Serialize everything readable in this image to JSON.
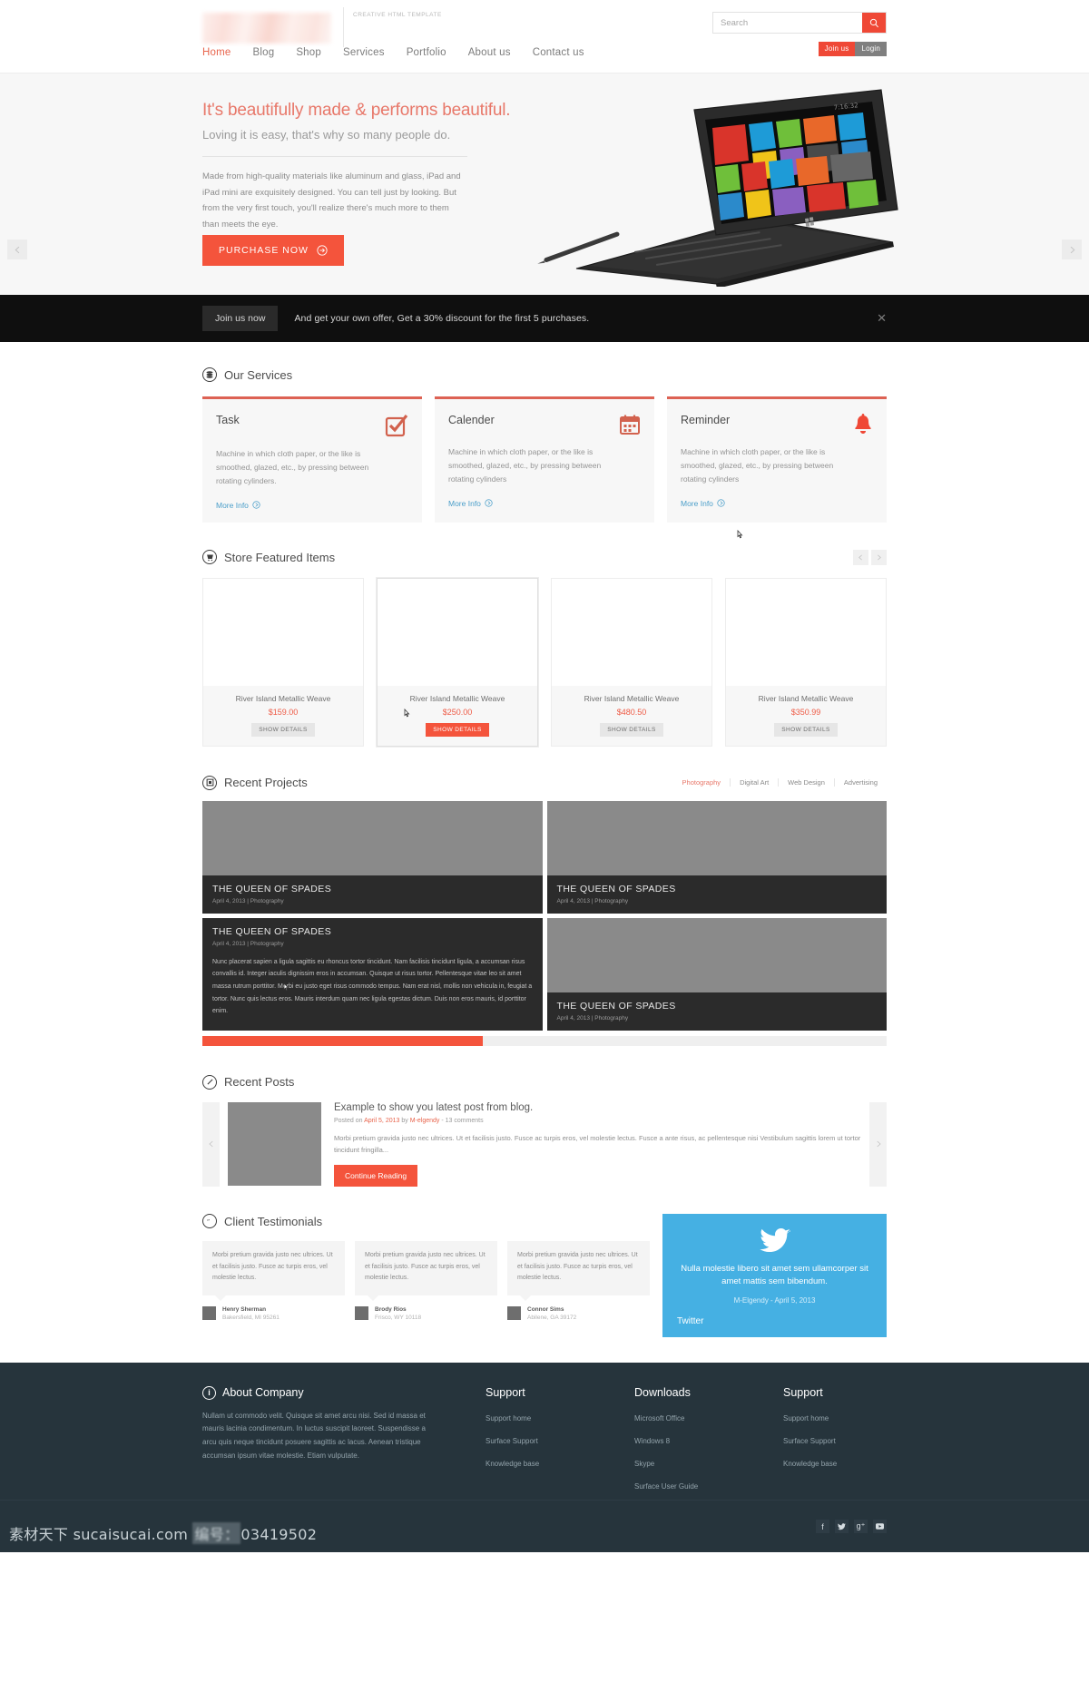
{
  "header": {
    "tagline": "CREATIVE HTML TEMPLATE",
    "nav": [
      {
        "label": "Home",
        "active": true
      },
      {
        "label": "Blog",
        "active": false
      },
      {
        "label": "Shop",
        "active": false
      },
      {
        "label": "Services",
        "active": false
      },
      {
        "label": "Portfolio",
        "active": false
      },
      {
        "label": "About us",
        "active": false
      },
      {
        "label": "Contact us",
        "active": false
      }
    ],
    "search": {
      "placeholder": "Search",
      "value": "",
      "icon": "search-icon"
    },
    "join_label": "Join us",
    "login_label": "Login"
  },
  "hero": {
    "title": "It's beautifully made & performs beautiful.",
    "subtitle": "Loving it is easy, that's why so many people do.",
    "body": "Made from high-quality materials like aluminum and glass, iPad and iPad mini are exquisitely designed. You can tell just by looking. But from the very first touch, you'll realize there's much more to them than meets the eye.",
    "cta": "PURCHASE NOW",
    "prev_icon": "chevron-left-icon",
    "next_icon": "chevron-right-icon",
    "device_screen_time": "7:16:32"
  },
  "promo": {
    "button": "Join us now",
    "text": "And get your own offer, Get a 30% discount for the first 5 purchases.",
    "close_icon": "close-icon"
  },
  "services": {
    "title": "Our Services",
    "icon": "layers-icon",
    "cards": [
      {
        "name": "Task",
        "icon": "checkbox-icon",
        "desc": "Machine in which cloth paper, or the like is smoothed, glazed, etc., by pressing between rotating cylinders.",
        "more": "More Info"
      },
      {
        "name": "Calender",
        "icon": "calendar-icon",
        "desc": "Machine in which cloth paper, or the like is smoothed, glazed, etc., by pressing between rotating cylinders",
        "more": "More Info"
      },
      {
        "name": "Reminder",
        "icon": "bell-icon",
        "desc": "Machine in which cloth paper, or the like is smoothed, glazed, etc., by pressing between rotating cylinders",
        "more": "More Info"
      }
    ]
  },
  "store": {
    "title": "Store Featured Items",
    "icon": "cart-icon",
    "prev_icon": "chevron-left-icon",
    "next_icon": "chevron-right-icon",
    "products": [
      {
        "name": "River Island Metallic Weave",
        "price": "$159.00",
        "button": "SHOW DETAILS",
        "active": false
      },
      {
        "name": "River Island Metallic Weave",
        "price": "$250.00",
        "button": "SHOW DETAILS",
        "active": true
      },
      {
        "name": "River Island Metallic Weave",
        "price": "$480.50",
        "button": "SHOW DETAILS",
        "active": false
      },
      {
        "name": "River Island Metallic Weave",
        "price": "$350.99",
        "button": "SHOW DETAILS",
        "active": false
      }
    ]
  },
  "projects": {
    "title": "Recent Projects",
    "icon": "image-icon",
    "filters": [
      {
        "label": "Photography",
        "active": true
      },
      {
        "label": "Digital Art",
        "active": false
      },
      {
        "label": "Web Design",
        "active": false
      },
      {
        "label": "Advertising",
        "active": false
      }
    ],
    "items": [
      {
        "title": "THE QUEEN OF SPADES",
        "meta": "April 4, 2013  |  Photography",
        "body": ""
      },
      {
        "title": "THE QUEEN OF SPADES",
        "meta": "April 4, 2013  |  Photography",
        "body": ""
      },
      {
        "title": "THE QUEEN OF SPADES",
        "meta": "April 4, 2013  |  Photography",
        "body": "Nunc placerat sapien a ligula sagittis eu rhoncus tortor tincidunt. Nam facilisis tincidunt ligula, a accumsan risus convallis id. Integer iaculis dignissim eros in accumsan. Quisque ut risus tortor. Pellentesque vitae leo sit amet massa rutrum porttitor. Morbi eu justo eget risus commodo tempus. Nam erat nisl, mollis non vehicula in, feugiat a tortor. Nunc quis lectus eros. Mauris interdum quam nec ligula egestas dictum. Duis non eros mauris, id porttitor enim."
      },
      {
        "title": "THE QUEEN OF SPADES",
        "meta": "April 4, 2013  |  Photography",
        "body": ""
      }
    ],
    "scroll_percent": 41
  },
  "posts": {
    "title": "Recent Posts",
    "icon": "pencil-icon",
    "prev_icon": "chevron-left-icon",
    "next_icon": "chevron-right-icon",
    "item": {
      "title": "Example to show you latest post from blog.",
      "meta_prefix": "Posted on ",
      "meta_date": "April 5, 2013",
      "meta_by": " by ",
      "meta_author": "M-elgendy",
      "meta_suffix": " - 13 comments",
      "excerpt": "Morbi pretium gravida justo nec ultrices. Ut et facilisis justo. Fusce ac turpis eros, vel molestie lectus. Fusce a ante risus, ac pellentesque nisi Vestibulum sagittis lorem ut tortor tincidunt fringilla...",
      "button": "Continue Reading"
    }
  },
  "testimonials": {
    "title": "Client Testimonials",
    "icon": "quote-icon",
    "items": [
      {
        "quote": "Morbi pretium gravida justo nec ultrices. Ut et facilisis justo. Fusce ac turpis eros, vel molestie lectus.",
        "name": "Henry Sherman",
        "location": "Bakersfield, MI 95261"
      },
      {
        "quote": "Morbi pretium gravida justo nec ultrices. Ut et facilisis justo. Fusce ac turpis eros, vel molestie lectus.",
        "name": "Brody Rios",
        "location": "Frisco, WY 10118"
      },
      {
        "quote": "Morbi pretium gravida justo nec ultrices. Ut et facilisis justo. Fusce ac turpis eros, vel molestie lectus.",
        "name": "Connor Sims",
        "location": "Abilene, GA 39172"
      }
    ],
    "tweet": {
      "icon": "twitter-bird-icon",
      "text": "Nulla molestie libero sit amet sem ullamcorper sit amet mattis sem bibendum.",
      "by": "M-Elgendy - April 5, 2013",
      "link": "Twitter"
    }
  },
  "footer": {
    "about": {
      "title": "About Company",
      "icon": "info-icon",
      "text": "Nullam ut commodo velit. Quisque sit amet arcu nisi. Sed id massa et mauris lacinia condimentum. In luctus suscipit laoreet. Suspendisse a arcu quis neque tincidunt posuere sagittis ac lacus. Aenean tristique accumsan ipsum vitae molestie. Etiam vulputate."
    },
    "columns": [
      {
        "title": "Support",
        "links": [
          "Support home",
          "Surface Support",
          "Knowledge base"
        ]
      },
      {
        "title": "Downloads",
        "links": [
          "Microsoft Office",
          "Windows 8",
          "Skype",
          "Surface User Guide"
        ]
      },
      {
        "title": "Support",
        "links": [
          "Support home",
          "Surface Support",
          "Knowledge base"
        ]
      }
    ],
    "social": [
      {
        "icon": "facebook-icon",
        "glyph": "f"
      },
      {
        "icon": "twitter-icon",
        "glyph": "ᵗ"
      },
      {
        "icon": "google-plus-icon",
        "glyph": "g⁺"
      },
      {
        "icon": "youtube-icon",
        "glyph": "▶"
      }
    ]
  },
  "watermark": {
    "prefix": "素材天下 sucaisucai.com ",
    "id_label": "编号：",
    "id_value": "03419502"
  },
  "colors": {
    "accent": "#f4543c",
    "accent_soft": "#e8786a",
    "link": "#4a9ec9",
    "twitter": "#45b0e3",
    "footer": "#26343c",
    "dark": "#2b2b2b"
  }
}
